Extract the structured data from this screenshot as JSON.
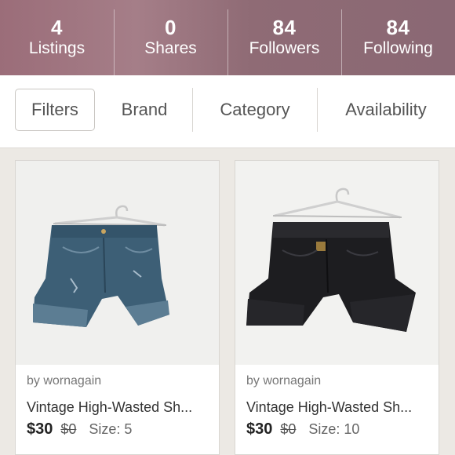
{
  "stats": [
    {
      "count": "4",
      "label": "Listings"
    },
    {
      "count": "0",
      "label": "Shares"
    },
    {
      "count": "84",
      "label": "Followers"
    },
    {
      "count": "84",
      "label": "Following"
    }
  ],
  "filter_bar": {
    "filters_label": "Filters",
    "brand_label": "Brand",
    "category_label": "Category",
    "availability_label": "Availability"
  },
  "listings": [
    {
      "seller": "by wornagain",
      "title": "Vintage High-Wasted Sh...",
      "price": "$30",
      "original_price": "$0",
      "size": "Size: 5",
      "image": "blue-denim-shorts-on-hanger"
    },
    {
      "seller": "by wornagain",
      "title": "Vintage High-Wasted Sh...",
      "price": "$30",
      "original_price": "$0",
      "size": "Size: 10",
      "image": "black-denim-shorts-on-hanger"
    }
  ],
  "colors": {
    "header_accent": "#9b6d79",
    "card_background": "#ffffff",
    "page_background": "#ece9e4"
  }
}
